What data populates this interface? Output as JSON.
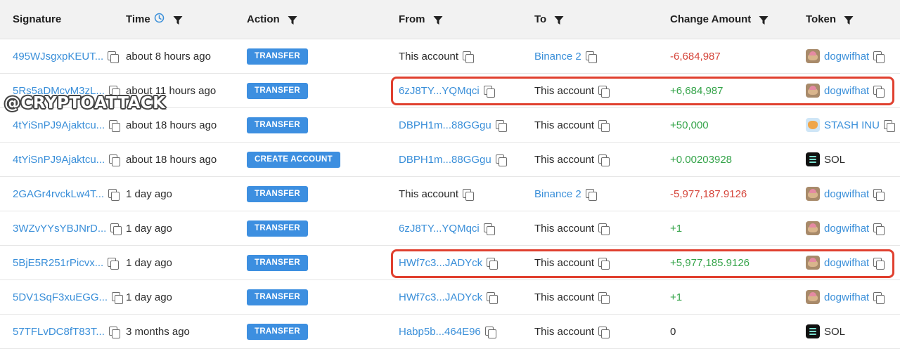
{
  "headers": {
    "signature": "Signature",
    "time": "Time",
    "action": "Action",
    "from": "From",
    "to": "To",
    "change_amount": "Change Amount",
    "token": "Token"
  },
  "rows": [
    {
      "signature": "495WJsgxpKEUT...",
      "time": "about 8 hours ago",
      "action": "TRANSFER",
      "from": "This account",
      "to": "Binance 2",
      "amount": "-6,684,987",
      "token": "dogwifhat"
    },
    {
      "signature": "5Rs5aDMcvM3zL...",
      "time": "about 11 hours ago",
      "action": "TRANSFER",
      "from": "6zJ8TY...YQMqci",
      "to": "This account",
      "amount": "+6,684,987",
      "token": "dogwifhat"
    },
    {
      "signature": "4tYiSnPJ9Ajaktcu...",
      "time": "about 18 hours ago",
      "action": "TRANSFER",
      "from": "DBPH1m...88GGgu",
      "to": "This account",
      "amount": "+50,000",
      "token": "STASH INU"
    },
    {
      "signature": "4tYiSnPJ9Ajaktcu...",
      "time": "about 18 hours ago",
      "action": "CREATE ACCOUNT",
      "from": "DBPH1m...88GGgu",
      "to": "This account",
      "amount": "+0.00203928",
      "token": "SOL"
    },
    {
      "signature": "2GAGr4rvckLw4T...",
      "time": "1 day ago",
      "action": "TRANSFER",
      "from": "This account",
      "to": "Binance 2",
      "amount": "-5,977,187.9126",
      "token": "dogwifhat"
    },
    {
      "signature": "3WZvYYsYBJNrD...",
      "time": "1 day ago",
      "action": "TRANSFER",
      "from": "6zJ8TY...YQMqci",
      "to": "This account",
      "amount": "+1",
      "token": "dogwifhat"
    },
    {
      "signature": "5BjE5R251rPicvx...",
      "time": "1 day ago",
      "action": "TRANSFER",
      "from": "HWf7c3...JADYck",
      "to": "This account",
      "amount": "+5,977,185.9126",
      "token": "dogwifhat"
    },
    {
      "signature": "5DV1SqF3xuEGG...",
      "time": "1 day ago",
      "action": "TRANSFER",
      "from": "HWf7c3...JADYck",
      "to": "This account",
      "amount": "+1",
      "token": "dogwifhat"
    },
    {
      "signature": "57TFLvDC8fT83T...",
      "time": "3 months ago",
      "action": "TRANSFER",
      "from": "Habp5b...464E96",
      "to": "This account",
      "amount": "0",
      "token": "SOL"
    }
  ],
  "watermark": "@CRYPTOATTACK",
  "colors": {
    "link": "#3a8fd9",
    "positive": "#35a44a",
    "negative": "#d5453a",
    "badge": "#3d8fe0",
    "highlight": "#e0402f"
  }
}
